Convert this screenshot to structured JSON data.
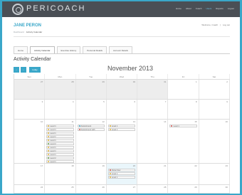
{
  "brand": {
    "logo_text": "PERICOACH"
  },
  "top_nav": [
    {
      "label": "Home",
      "active": false
    },
    {
      "label": "About",
      "active": false
    },
    {
      "label": "Coach",
      "active": false
    },
    {
      "label": "Users",
      "active": true
    },
    {
      "label": "Reports",
      "active": false
    },
    {
      "label": "Logout",
      "active": false
    }
  ],
  "page": {
    "user_name": "JANE PERON",
    "breadcrumb": [
      "Dashboard",
      "Activity Calendar"
    ],
    "account_links": [
      "Welcome, Coach",
      "|",
      "Log out"
    ]
  },
  "tabs": [
    {
      "label": "Home",
      "active": false
    },
    {
      "label": "Activity Calendar",
      "active": true
    },
    {
      "label": "Exercise History",
      "active": false
    },
    {
      "label": "Personal Details",
      "active": false
    },
    {
      "label": "Account Details",
      "active": false
    }
  ],
  "calendar": {
    "title": "Activity Calendar",
    "prev_label": "‹",
    "next_label": "›",
    "today_label": "today",
    "month_title": "November 2013",
    "weekdays": [
      "Sun",
      "Mon",
      "Tue",
      "Wed",
      "Thu",
      "Fri",
      "Sat"
    ],
    "weeks": [
      {
        "height": 28,
        "days": [
          {
            "num": "27",
            "shaded": true,
            "events": []
          },
          {
            "num": "28",
            "shaded": true,
            "events": []
          },
          {
            "num": "29",
            "shaded": true,
            "events": []
          },
          {
            "num": "30",
            "shaded": true,
            "events": []
          },
          {
            "num": "31",
            "shaded": true,
            "events": []
          },
          {
            "num": "1",
            "shaded": false,
            "events": []
          },
          {
            "num": "2",
            "shaded": false,
            "events": []
          }
        ]
      },
      {
        "height": 28,
        "days": [
          {
            "num": "3",
            "shaded": false,
            "events": []
          },
          {
            "num": "4",
            "shaded": false,
            "events": []
          },
          {
            "num": "5",
            "shaded": false,
            "events": []
          },
          {
            "num": "6",
            "shaded": false,
            "events": []
          },
          {
            "num": "7",
            "shaded": false,
            "events": []
          },
          {
            "num": "8",
            "shaded": false,
            "events": []
          },
          {
            "num": "9",
            "shaded": false,
            "events": []
          }
        ]
      },
      {
        "height": 62,
        "days": [
          {
            "num": "10",
            "shaded": false,
            "events": []
          },
          {
            "num": "11",
            "shaded": false,
            "events": [
              {
                "label": "Level 1",
                "color": "#e8b93a"
              },
              {
                "label": "Level 1",
                "color": "#e8b93a"
              },
              {
                "label": "Level 1",
                "color": "#e8b93a"
              },
              {
                "label": "Level 1",
                "color": "#e8b93a"
              },
              {
                "label": "Level 1",
                "color": "#e8b93a"
              },
              {
                "label": "Level 2",
                "color": "#6aa84f"
              },
              {
                "label": "Level 1",
                "color": "#e8b93a"
              },
              {
                "label": "Level 1",
                "color": "#e8b93a"
              },
              {
                "label": "Level 1",
                "color": "#e8b93a"
              },
              {
                "label": "Level 2",
                "color": "#6aa84f"
              },
              {
                "label": "Level 1",
                "color": "#e8b93a"
              },
              {
                "label": "Level 1",
                "color": "#e8b93a"
              }
            ]
          },
          {
            "num": "12",
            "shaded": false,
            "events": [
              {
                "label": "Appointment",
                "color": "#3aa7c9"
              },
              {
                "label": "Appointment with",
                "color": "#d9534f"
              }
            ]
          },
          {
            "num": "13",
            "shaded": false,
            "events": [
              {
                "label": "Level 1",
                "color": "#e8b93a"
              },
              {
                "label": "Level 1",
                "color": "#e8b93a"
              }
            ]
          },
          {
            "num": "14",
            "shaded": false,
            "events": []
          },
          {
            "num": "15",
            "shaded": false,
            "events": [
              {
                "label": "Level 1",
                "color": "#d9534f"
              }
            ]
          },
          {
            "num": "16",
            "shaded": false,
            "events": []
          }
        ]
      },
      {
        "height": 30,
        "days": [
          {
            "num": "17",
            "shaded": false,
            "events": []
          },
          {
            "num": "18",
            "shaded": false,
            "events": []
          },
          {
            "num": "19",
            "shaded": false,
            "events": []
          },
          {
            "num": "20",
            "shaded": false,
            "today": true,
            "events": [
              {
                "label": "Pelvic floor",
                "color": "#d9534f"
              },
              {
                "label": "Level 1",
                "color": "#e8b93a"
              },
              {
                "label": "Level 1",
                "color": "#e8b93a"
              }
            ]
          },
          {
            "num": "21",
            "shaded": false,
            "events": []
          },
          {
            "num": "22",
            "shaded": false,
            "events": []
          },
          {
            "num": "23",
            "shaded": false,
            "events": []
          }
        ]
      },
      {
        "height": 12,
        "days": [
          {
            "num": "24",
            "shaded": false,
            "events": []
          },
          {
            "num": "25",
            "shaded": false,
            "events": []
          },
          {
            "num": "26",
            "shaded": false,
            "events": []
          },
          {
            "num": "27",
            "shaded": false,
            "events": []
          },
          {
            "num": "28",
            "shaded": false,
            "events": []
          },
          {
            "num": "29",
            "shaded": false,
            "events": []
          },
          {
            "num": "30",
            "shaded": false,
            "events": []
          }
        ]
      }
    ]
  }
}
